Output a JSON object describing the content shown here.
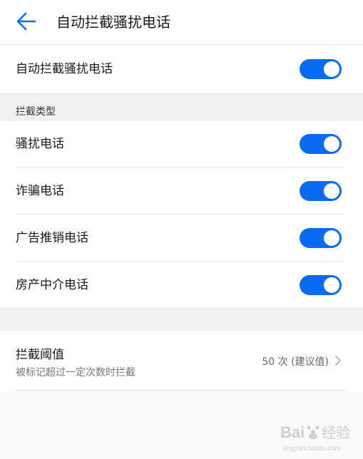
{
  "header": {
    "back_icon": "arrow-left-icon",
    "title": "自动拦截骚扰电话",
    "accent_color": "#0a6af0"
  },
  "main_toggle": {
    "label": "自动拦截骚扰电话",
    "enabled": true
  },
  "intercept_types": {
    "section_label": "拦截类型",
    "items": [
      {
        "label": "骚扰电话",
        "enabled": true
      },
      {
        "label": "诈骗电话",
        "enabled": true
      },
      {
        "label": "广告推销电话",
        "enabled": true
      },
      {
        "label": "房产中介电话",
        "enabled": true
      }
    ]
  },
  "threshold": {
    "label": "拦截阈值",
    "description": "被标记超过一定次数时拦截",
    "value": "50 次 (建议值)",
    "chevron_icon": "chevron-right-icon"
  },
  "watermark": {
    "brand": "Bai  经验",
    "url": "jingyan.baidu.com"
  }
}
